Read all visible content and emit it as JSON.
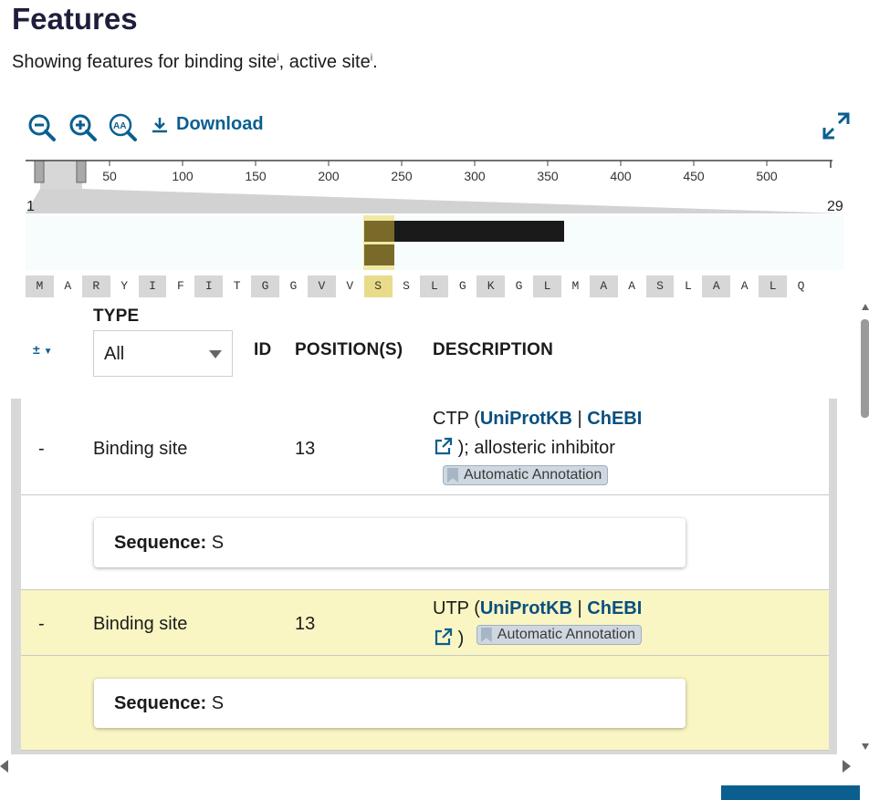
{
  "header": {
    "title": "Features",
    "subtitle_prefix": "Showing features for ",
    "filter1": "binding site",
    "sep": ", ",
    "filter2": "active site",
    "suffix": ".",
    "info_mark": "i"
  },
  "toolbar": {
    "zoom_out_icon": "zoom-out-icon",
    "zoom_in_icon": "zoom-in-icon",
    "text_size_icon": "text-size-icon",
    "download_label": "Download",
    "expand_icon": "expand-icon"
  },
  "ruler": {
    "ticks": [
      "50",
      "100",
      "150",
      "200",
      "250",
      "300",
      "350",
      "400",
      "450",
      "500"
    ],
    "range_start": "1",
    "range_end": "29"
  },
  "sequence": [
    "M",
    "A",
    "R",
    "Y",
    "I",
    "F",
    "I",
    "T",
    "G",
    "G",
    "V",
    "V",
    "S",
    "S",
    "L",
    "G",
    "K",
    "G",
    "L",
    "M",
    "A",
    "A",
    "S",
    "L",
    "A",
    "A",
    "L",
    "Q"
  ],
  "sequence_highlight_index": 12,
  "table": {
    "sort_control": "±",
    "headers": {
      "type": "TYPE",
      "id": "ID",
      "positions": "POSITION(S)",
      "description": "DESCRIPTION"
    },
    "type_filter_value": "All",
    "rows": [
      {
        "expander": "-",
        "type": "Binding site",
        "position": "13",
        "desc_prefix": "CTP (",
        "link1": "UniProtKB",
        "pipe": " | ",
        "link2": "ChEBI",
        "desc_after": "); allosteric inhibitor",
        "badge": "Automatic Annotation",
        "seq_label": "Sequence:",
        "seq_value": "S"
      },
      {
        "expander": "-",
        "type": "Binding site",
        "position": "13",
        "desc_prefix": "UTP (",
        "link1": "UniProtKB",
        "pipe": " | ",
        "link2": "ChEBI",
        "desc_after": ")",
        "badge": "Automatic Annotation",
        "seq_label": "Sequence:",
        "seq_value": "S"
      }
    ]
  },
  "colors": {
    "accent": "#0b5f8f",
    "highlight_row": "#faf6c4",
    "track_bar": "#1a1a1a",
    "track_highlight": "#7a6a2a"
  }
}
